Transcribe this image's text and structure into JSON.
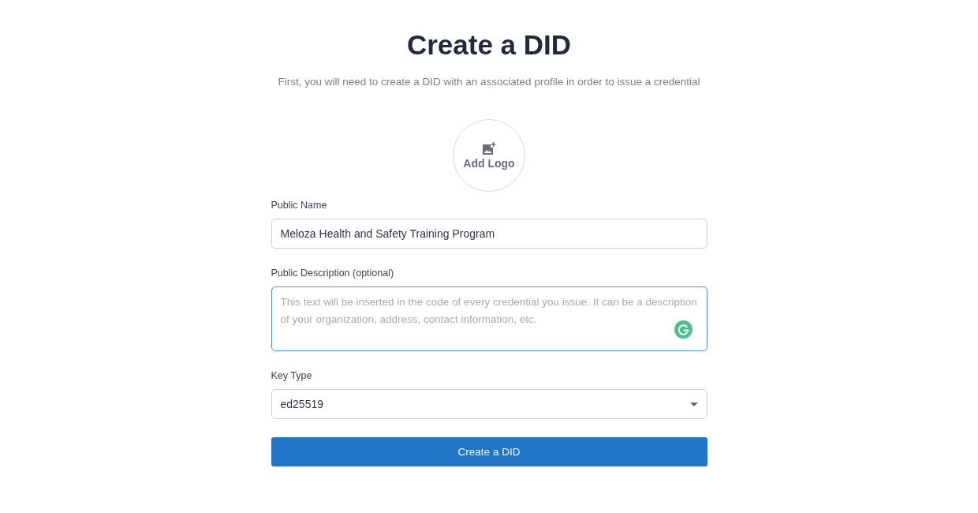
{
  "title": "Create a DID",
  "subtitle": "First, you will need to create a DID with an associated profile in order to issue a credential",
  "logo_upload": {
    "label": "Add Logo"
  },
  "fields": [
    {
      "kind": "text",
      "label": "Public Name",
      "value": "Meloza Health and Safety Training Program",
      "focused": false
    },
    {
      "kind": "textarea",
      "label": "Public Description (optional)",
      "placeholder": "This text will be inserted in the code of every credential you issue. It can be a description of your organization, address, contact information, etc.",
      "focused": true
    },
    {
      "kind": "select",
      "label": "Key Type",
      "value": "ed25519",
      "focused": false
    }
  ],
  "submit_button": "Create a DID"
}
